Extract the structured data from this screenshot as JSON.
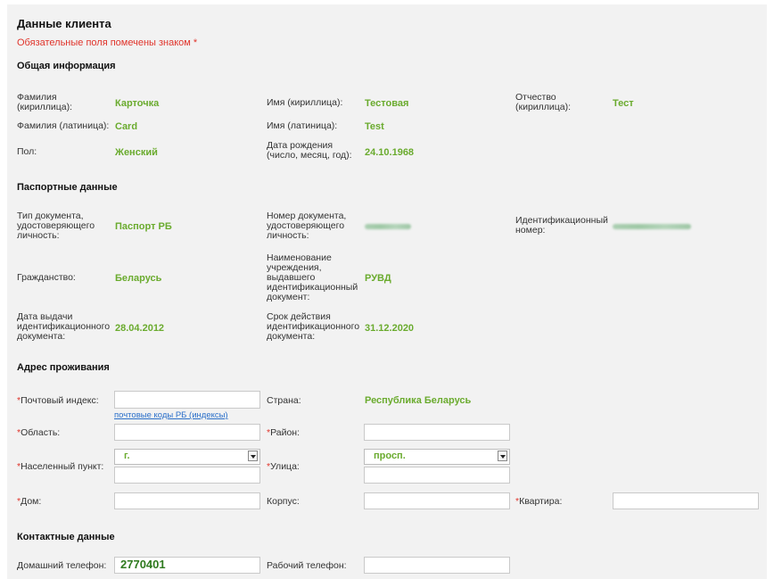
{
  "header": {
    "title": "Данные клиента",
    "required_note": "Обязательные поля помечены знаком *"
  },
  "general": {
    "section_title": "Общая информация",
    "surname_cyr_label": "Фамилия (кириллица):",
    "surname_cyr_value": "Карточка",
    "name_cyr_label": "Имя (кириллица):",
    "name_cyr_value": "Тестовая",
    "patronymic_label": "Отчество (кириллица):",
    "patronymic_value": "Тест",
    "surname_lat_label": "Фамилия (латиница):",
    "surname_lat_value": "Card",
    "name_lat_label": "Имя (латиница):",
    "name_lat_value": "Test",
    "gender_label": "Пол:",
    "gender_value": "Женский",
    "birthdate_label": "Дата рождения (число, месяц, год):",
    "birthdate_value": "24.10.1968"
  },
  "passport": {
    "section_title": "Паспортные данные",
    "doc_type_label": "Тип документа, удостоверяющего личность:",
    "doc_type_value": "Паспорт РБ",
    "doc_number_label": "Номер документа, удостоверяющего личность:",
    "id_number_label": "Идентификационный номер:",
    "citizenship_label": "Гражданство:",
    "citizenship_value": "Беларусь",
    "issuer_label": "Наименование учреждения, выдавшего идентификационный документ:",
    "issuer_value": "РУВД",
    "issue_date_label": "Дата выдачи идентификационного документа:",
    "issue_date_value": "28.04.2012",
    "expiry_label": "Срок действия идентификационного документа:",
    "expiry_value": "31.12.2020"
  },
  "address": {
    "section_title": "Адрес проживания",
    "postal_label": "Почтовый индекс:",
    "postal_value": "",
    "postal_link": "почтовые коды РБ (индексы)",
    "country_label": "Страна:",
    "country_value": "Республика Беларусь",
    "region_label": "Область:",
    "district_label": "Район:",
    "locality_label": "Населенный пункт:",
    "locality_type": "г.",
    "street_label": "Улица:",
    "street_type": "просп.",
    "house_label": "Дом:",
    "building_label": "Корпус:",
    "apartment_label": "Квартира:"
  },
  "contacts": {
    "section_title": "Контактные данные",
    "home_phone_label": "Домашний телефон:",
    "home_phone_value": "2770401",
    "work_phone_label": "Рабочий телефон:"
  },
  "colors": {
    "value_green": "#6aab2e",
    "required_red": "#e0342b",
    "link_blue": "#2a6fc9"
  }
}
